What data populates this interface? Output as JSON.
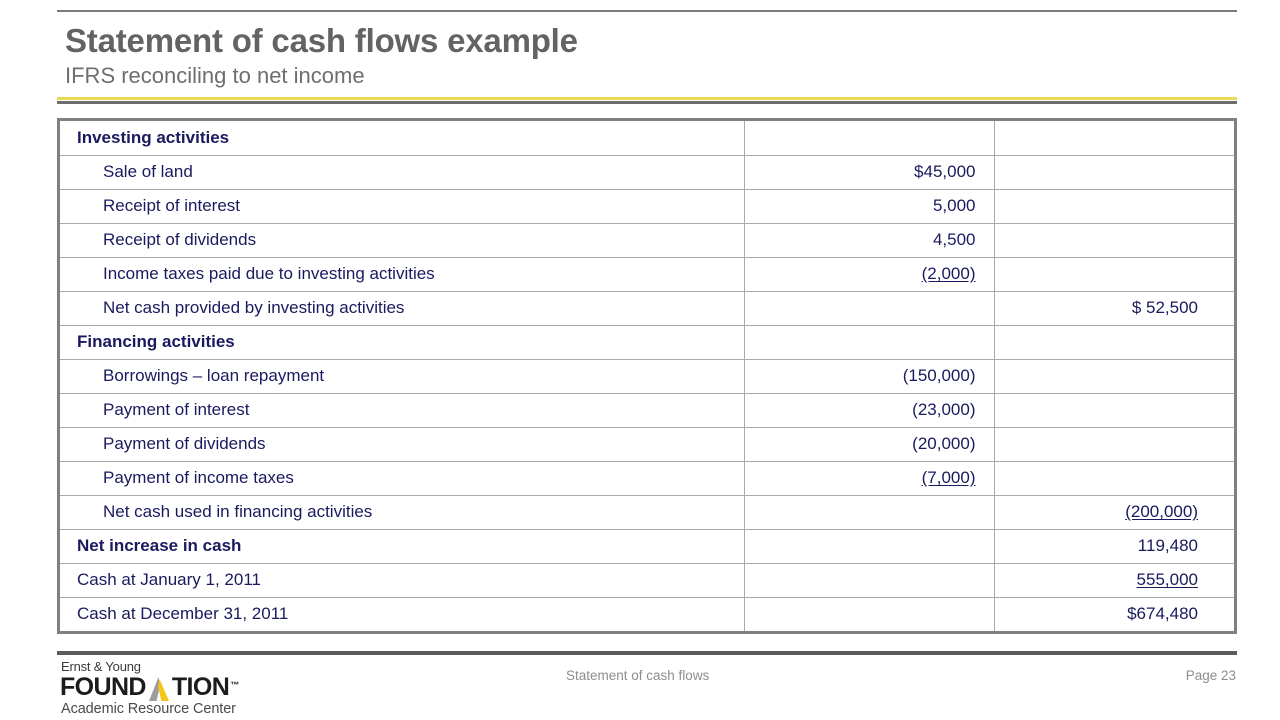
{
  "header": {
    "title": "Statement of cash flows example",
    "subtitle": "IFRS reconciling to net income",
    "accent_yellow": "#e8da52",
    "accent_gray": "#6d6d6d"
  },
  "table": {
    "text_color": "#1a1a5e",
    "border_color": "#808080",
    "rows": [
      {
        "label": "Investing activities",
        "style": "section",
        "mid": "",
        "total": ""
      },
      {
        "label": "Sale of land",
        "style": "item",
        "mid": "$45,000",
        "total": ""
      },
      {
        "label": "Receipt of interest",
        "style": "item",
        "mid": "5,000",
        "total": ""
      },
      {
        "label": "Receipt of dividends",
        "style": "item",
        "mid": "4,500",
        "total": ""
      },
      {
        "label": "Income taxes paid due to investing activities",
        "style": "item",
        "mid": "(2,000)",
        "total": "",
        "mid_underline": true
      },
      {
        "label": "Net cash provided by investing activities",
        "style": "item",
        "mid": "",
        "total": "$  52,500"
      },
      {
        "label": "Financing activities",
        "style": "section",
        "mid": "",
        "total": ""
      },
      {
        "label": "Borrowings – loan repayment",
        "style": "item",
        "mid": "(150,000)",
        "total": ""
      },
      {
        "label": "Payment of interest",
        "style": "item",
        "mid": "(23,000)",
        "total": ""
      },
      {
        "label": "Payment of dividends",
        "style": "item",
        "mid": "(20,000)",
        "total": ""
      },
      {
        "label": "Payment of income taxes",
        "style": "item",
        "mid": "(7,000)",
        "total": "",
        "mid_underline": true
      },
      {
        "label": "Net cash used in financing activities",
        "style": "item",
        "mid": "",
        "total": "(200,000)",
        "total_underline": true
      },
      {
        "label": "Net increase in cash",
        "style": "section",
        "mid": "",
        "total": "119,480"
      },
      {
        "label": "Cash at January 1, 2011",
        "style": "flush",
        "mid": "",
        "total": "555,000",
        "total_underline": true
      },
      {
        "label": "Cash at December 31, 2011",
        "style": "flush",
        "mid": "",
        "total": "$674,480"
      }
    ]
  },
  "footer": {
    "logo_line1": "Ernst & Young",
    "logo_word_left": "FOUND",
    "logo_word_right": "TION",
    "logo_tm": "™",
    "logo_line3": "Academic Resource Center",
    "logo_mark_gray": "#9d9d9d",
    "logo_mark_yellow": "#f5c518",
    "center_text": "Statement of cash flows",
    "page_text": "Page 23"
  }
}
